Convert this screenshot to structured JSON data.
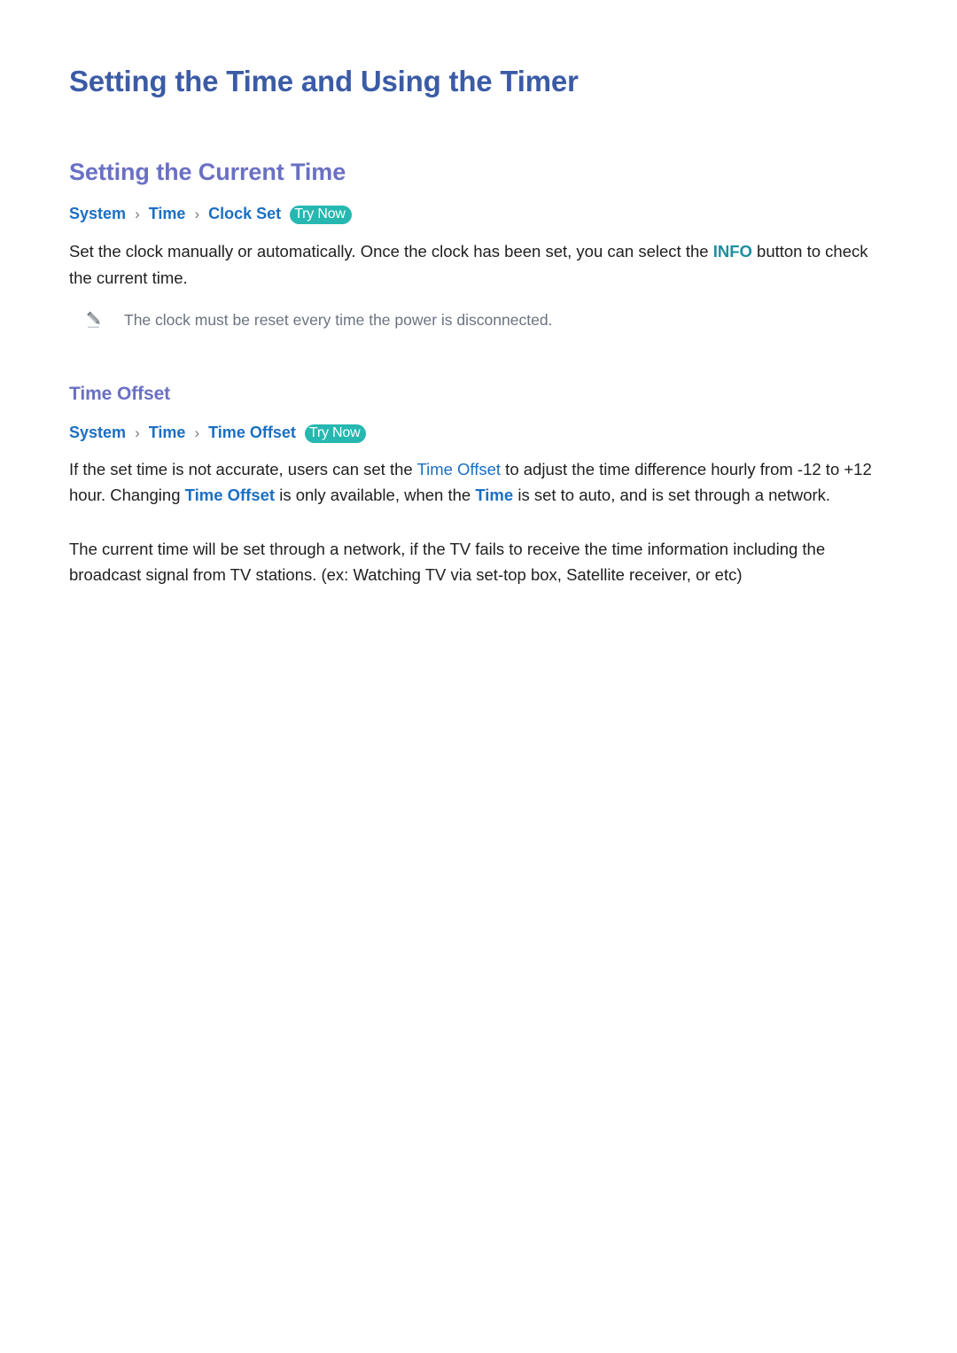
{
  "document": {
    "title": "Setting the Time and Using the Timer"
  },
  "sections": [
    {
      "heading": "Setting the Current Time",
      "breadcrumb": {
        "items": [
          "System",
          "Time",
          "Clock Set"
        ],
        "separator": "›",
        "badge": "Try Now"
      },
      "paragraph": {
        "part1": "Set the clock manually or automatically. Once the clock has been set, you can select the ",
        "highlight": "INFO",
        "part2": " button to check the current time."
      },
      "note": {
        "icon": "pencil-icon",
        "text": "The clock must be reset every time the power is disconnected."
      }
    },
    {
      "heading": "Time Offset",
      "breadcrumb": {
        "items": [
          "System",
          "Time",
          "Time Offset"
        ],
        "separator": "›",
        "badge": "Try Now"
      },
      "paragraph1": {
        "part1": "If the set time is not accurate, users can set the ",
        "highlight1": "Time Offset",
        "part2": " to adjust the time difference hourly from -12 to +12 hour. Changing ",
        "highlight2": "Time Offset",
        "part3": " is only available, when the ",
        "highlight3": "Time",
        "part4": " is set to auto, and is set through a network."
      },
      "paragraph2": "The current time will be set through a network, if the TV fails to receive the time information including the broadcast signal from TV stations. (ex: Watching TV via set-top box, Satellite receiver, or etc)"
    }
  ],
  "colors": {
    "title": "#3b5ba5",
    "heading": "#6a70c4",
    "breadcrumb": "#1a6fc4",
    "badge_bg": "#26b8b0",
    "highlight_teal": "#1a8fa0",
    "highlight_blue": "#1a6fc4",
    "body": "#1f1f1f",
    "note": "#6b7280"
  }
}
